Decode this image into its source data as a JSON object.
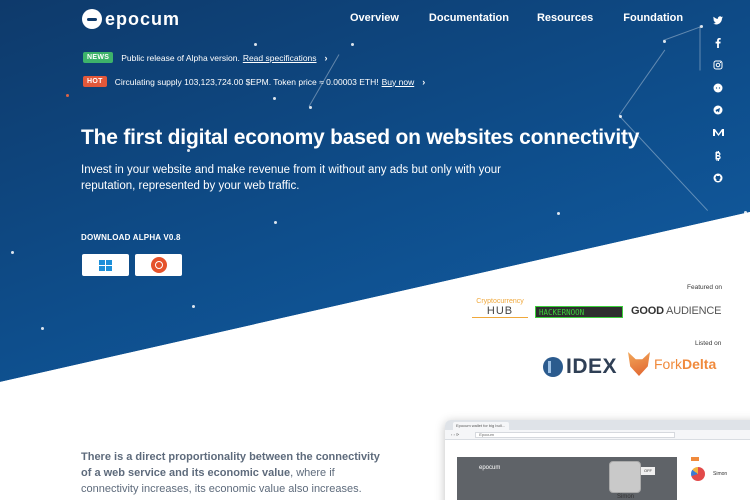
{
  "brand": {
    "logo_text": "epocum"
  },
  "nav": {
    "items": [
      {
        "label": "Overview"
      },
      {
        "label": "Documentation"
      },
      {
        "label": "Resources"
      },
      {
        "label": "Foundation"
      }
    ]
  },
  "social": {
    "icons": [
      "twitter-icon",
      "facebook-icon",
      "instagram-icon",
      "reddit-icon",
      "telegram-icon",
      "medium-icon",
      "bitcoin-icon",
      "github-icon"
    ]
  },
  "announcements": {
    "news": {
      "badge": "NEWS",
      "text": "Public release of Alpha version.",
      "link": "Read specifications",
      "chevron": "›"
    },
    "hot": {
      "badge": "HOT",
      "text": "Circulating supply 103,123,724.00 $EPM. Token price ≈ 0.00003 ETH!",
      "link": "Buy now",
      "chevron": "›"
    }
  },
  "hero": {
    "title": "The first digital economy based on websites connectivity",
    "subtitle": "Invest in your website and make revenue from it without any ads but only with your reputation, represented by your web traffic.",
    "download_title": "DOWNLOAD ALPHA V0.8",
    "download_buttons": [
      {
        "platform": "windows",
        "icon": "windows-icon"
      },
      {
        "platform": "ubuntu",
        "icon": "ubuntu-icon"
      }
    ]
  },
  "featured": {
    "label": "Featured on",
    "logos": {
      "crypto_top": "Cryptocurrency",
      "crypto_bottom": "HUB",
      "hackernoon": "HACKERNOON",
      "good": "GOOD",
      "audience": " AUDIENCE"
    }
  },
  "listed": {
    "label": "Listed on",
    "idex": "IDEX",
    "fork": "Fork",
    "delta": "Delta"
  },
  "intro": {
    "bold": "There is a direct proportionality between the connectivity of a web service and its economic value",
    "rest": ", where if connectivity increases, its economic value also increases."
  },
  "mockup": {
    "tab_label": "Epocum wallet for big bull...",
    "address": "Epocum",
    "inner_logo": "epocum",
    "off_label": "OFF",
    "user_name": "Simon",
    "panel_name": "Simon"
  }
}
